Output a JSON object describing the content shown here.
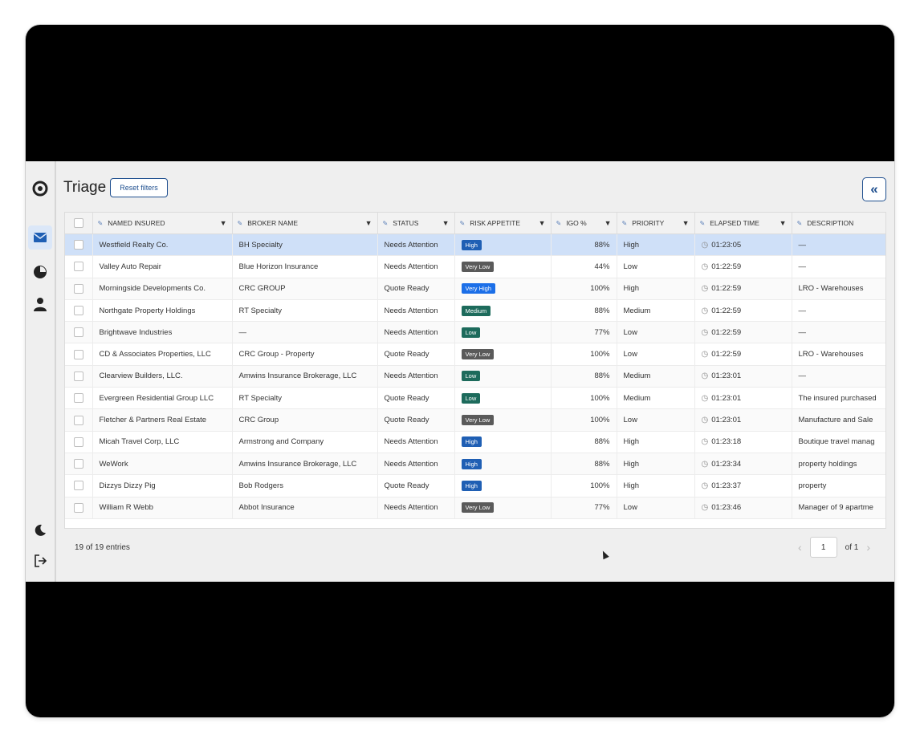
{
  "page": {
    "title": "Triage",
    "reset_label": "Reset filters",
    "collapse_label": "«"
  },
  "columns": [
    "",
    "NAMED INSURED",
    "BROKER NAME",
    "STATUS",
    "RISK APPETITE",
    "IGO %",
    "PRIORITY",
    "ELAPSED TIME",
    "DESCRIPTION"
  ],
  "badge_colors": {
    "High": "#1f5fb4",
    "Very Low": "#5a5a5a",
    "Very High": "#1c6fe8",
    "Medium": "#1d6b5c",
    "Low": "#1d6b5c"
  },
  "rows": [
    {
      "named_insured": "Westfield Realty Co.",
      "broker": "BH Specialty",
      "status": "Needs Attention",
      "risk": "High",
      "igo": "88%",
      "priority": "High",
      "elapsed": "01:23:05",
      "description": "—"
    },
    {
      "named_insured": "Valley Auto Repair",
      "broker": "Blue Horizon Insurance",
      "status": "Needs Attention",
      "risk": "Very Low",
      "igo": "44%",
      "priority": "Low",
      "elapsed": "01:22:59",
      "description": "—"
    },
    {
      "named_insured": "Morningside Developments Co.",
      "broker": "CRC GROUP",
      "status": "Quote Ready",
      "risk": "Very High",
      "igo": "100%",
      "priority": "High",
      "elapsed": "01:22:59",
      "description": "LRO - Warehouses"
    },
    {
      "named_insured": "Northgate Property Holdings",
      "broker": "RT Specialty",
      "status": "Needs Attention",
      "risk": "Medium",
      "igo": "88%",
      "priority": "Medium",
      "elapsed": "01:22:59",
      "description": "—"
    },
    {
      "named_insured": "Brightwave Industries",
      "broker": "—",
      "status": "Needs Attention",
      "risk": "Low",
      "igo": "77%",
      "priority": "Low",
      "elapsed": "01:22:59",
      "description": "—"
    },
    {
      "named_insured": "CD & Associates Properties, LLC",
      "broker": "CRC Group - Property",
      "status": "Quote Ready",
      "risk": "Very Low",
      "igo": "100%",
      "priority": "Low",
      "elapsed": "01:22:59",
      "description": "LRO - Warehouses"
    },
    {
      "named_insured": "Clearview Builders, LLC.",
      "broker": "Amwins Insurance Brokerage, LLC",
      "status": "Needs Attention",
      "risk": "Low",
      "igo": "88%",
      "priority": "Medium",
      "elapsed": "01:23:01",
      "description": "—"
    },
    {
      "named_insured": "Evergreen Residential Group LLC",
      "broker": "RT Specialty",
      "status": "Quote Ready",
      "risk": "Low",
      "igo": "100%",
      "priority": "Medium",
      "elapsed": "01:23:01",
      "description": "The insured purchased"
    },
    {
      "named_insured": "Fletcher & Partners Real Estate",
      "broker": "CRC Group",
      "status": "Quote Ready",
      "risk": "Very Low",
      "igo": "100%",
      "priority": "Low",
      "elapsed": "01:23:01",
      "description": "Manufacture and Sale"
    },
    {
      "named_insured": "Micah Travel Corp, LLC",
      "broker": "Armstrong and Company",
      "status": "Needs Attention",
      "risk": "High",
      "igo": "88%",
      "priority": "High",
      "elapsed": "01:23:18",
      "description": "Boutique travel manag"
    },
    {
      "named_insured": "WeWork",
      "broker": "Amwins Insurance Brokerage, LLC",
      "status": "Needs Attention",
      "risk": "High",
      "igo": "88%",
      "priority": "High",
      "elapsed": "01:23:34",
      "description": "property holdings"
    },
    {
      "named_insured": "Dizzys Dizzy Pig",
      "broker": "Bob Rodgers",
      "status": "Quote Ready",
      "risk": "High",
      "igo": "100%",
      "priority": "High",
      "elapsed": "01:23:37",
      "description": "property"
    },
    {
      "named_insured": "William R Webb",
      "broker": "Abbot Insurance",
      "status": "Needs Attention",
      "risk": "Very Low",
      "igo": "77%",
      "priority": "Low",
      "elapsed": "01:23:46",
      "description": "Manager of 9 apartme"
    }
  ],
  "footer": {
    "count": "19 of 19 entries",
    "page_value": "1",
    "of_label": "of 1"
  }
}
